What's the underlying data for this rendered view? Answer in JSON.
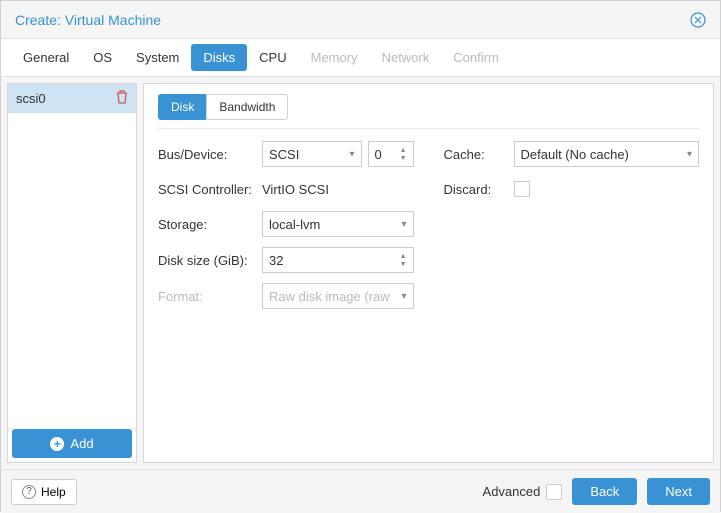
{
  "window": {
    "title": "Create: Virtual Machine"
  },
  "tabs": [
    {
      "label": "General",
      "state": "normal"
    },
    {
      "label": "OS",
      "state": "normal"
    },
    {
      "label": "System",
      "state": "normal"
    },
    {
      "label": "Disks",
      "state": "active"
    },
    {
      "label": "CPU",
      "state": "normal"
    },
    {
      "label": "Memory",
      "state": "disabled"
    },
    {
      "label": "Network",
      "state": "disabled"
    },
    {
      "label": "Confirm",
      "state": "disabled"
    }
  ],
  "sidebar": {
    "items": [
      {
        "label": "scsi0"
      }
    ],
    "add_label": "Add"
  },
  "inner_tabs": {
    "disk": "Disk",
    "bandwidth": "Bandwidth"
  },
  "form": {
    "left": {
      "bus_device": {
        "label": "Bus/Device:",
        "bus": "SCSI",
        "device": "0"
      },
      "scsi_controller": {
        "label": "SCSI Controller:",
        "value": "VirtIO SCSI"
      },
      "storage": {
        "label": "Storage:",
        "value": "local-lvm"
      },
      "disk_size": {
        "label": "Disk size (GiB):",
        "value": "32"
      },
      "format": {
        "label": "Format:",
        "value": "Raw disk image (raw"
      }
    },
    "right": {
      "cache": {
        "label": "Cache:",
        "value": "Default (No cache)"
      },
      "discard": {
        "label": "Discard:"
      }
    }
  },
  "footer": {
    "help": "Help",
    "advanced": "Advanced",
    "back": "Back",
    "next": "Next"
  }
}
